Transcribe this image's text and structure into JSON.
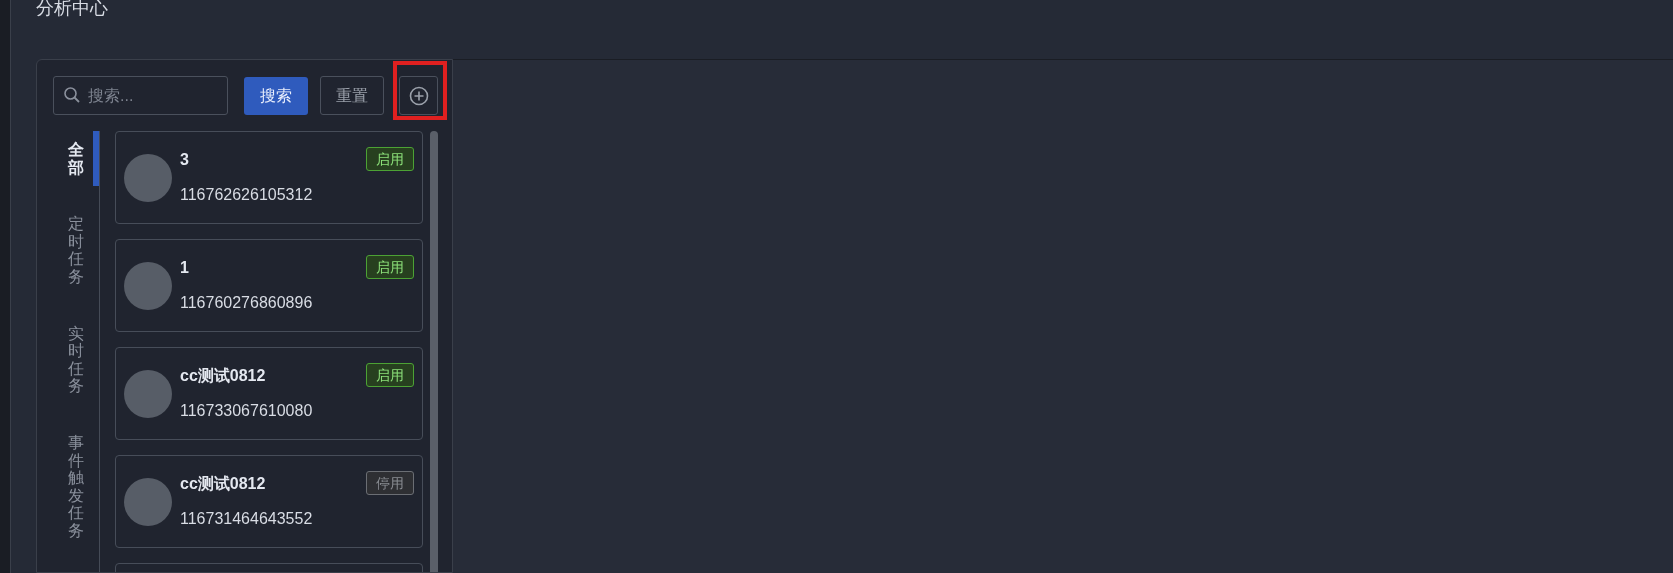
{
  "page_title": "分析中心",
  "search": {
    "placeholder": "搜索..."
  },
  "buttons": [
    {
      "kind": "primary",
      "label": "搜索"
    },
    {
      "kind": "outline",
      "label": "重置"
    },
    {
      "kind": "add",
      "highlighted": true
    }
  ],
  "tabs": [
    {
      "label": "全部",
      "selected": true
    },
    {
      "label": "定时任务",
      "selected": false
    },
    {
      "label": "实时任务",
      "selected": false
    },
    {
      "label": "事件触发任务",
      "selected": false
    }
  ],
  "cards": [
    {
      "kind": "task",
      "name": "3",
      "id": "116762626105312",
      "status": {
        "label": "启用",
        "enabled": true
      }
    },
    {
      "kind": "task",
      "name": "1",
      "id": "116760276860896",
      "status": {
        "label": "启用",
        "enabled": true
      }
    },
    {
      "kind": "task",
      "name": "cc测试0812",
      "id": "116733067610080",
      "status": {
        "label": "启用",
        "enabled": true
      }
    },
    {
      "kind": "task",
      "name": "cc测试0812",
      "id": "116731464643552",
      "status": {
        "label": "停用",
        "enabled": false
      }
    },
    {
      "kind": "cut-off"
    }
  ]
}
